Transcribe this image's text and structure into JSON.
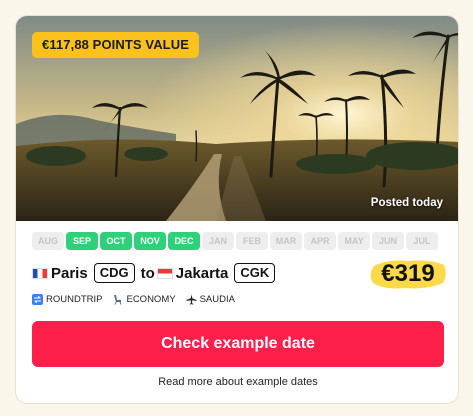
{
  "deal": {
    "points_badge": "€117,88 POINTS VALUE",
    "posted": "Posted today",
    "months": [
      {
        "label": "AUG",
        "active": false
      },
      {
        "label": "SEP",
        "active": true
      },
      {
        "label": "OCT",
        "active": true
      },
      {
        "label": "NOV",
        "active": true
      },
      {
        "label": "DEC",
        "active": true
      },
      {
        "label": "JAN",
        "active": false
      },
      {
        "label": "FEB",
        "active": false
      },
      {
        "label": "MAR",
        "active": false
      },
      {
        "label": "APR",
        "active": false
      },
      {
        "label": "MAY",
        "active": false
      },
      {
        "label": "JUN",
        "active": false
      },
      {
        "label": "JUL",
        "active": false
      }
    ],
    "route": {
      "origin_city": "Paris",
      "origin_code": "CDG",
      "connector": "to",
      "destination_city": "Jakarta",
      "destination_code": "CGK"
    },
    "price": "€319",
    "meta": {
      "trip_type": "ROUNDTRIP",
      "cabin": "ECONOMY",
      "airline": "SAUDIA"
    },
    "cta_label": "Check example date",
    "more_link": "Read more about example dates"
  },
  "icons": {
    "origin_flag": "france-flag-icon",
    "destination_flag": "indonesia-flag-icon",
    "trip_type": "roundtrip-arrows-icon",
    "cabin": "seat-icon",
    "airline": "airplane-icon"
  },
  "colors": {
    "badge": "#fbc21e",
    "active_month": "#2fd07a",
    "inactive_month": "#eeeeee",
    "cta": "#ff1f4b",
    "price_highlight": "#fbd94a",
    "background": "#fbf6ea"
  }
}
